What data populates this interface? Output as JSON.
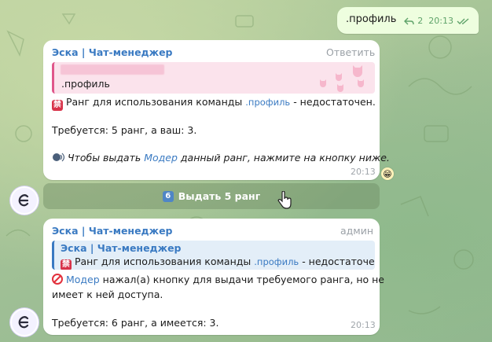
{
  "outgoing": {
    "text": ".профиль",
    "reply_count": "2",
    "time": "20:13",
    "check_icon": "double-check-icon",
    "reply_icon": "reply-arrow-icon"
  },
  "msg1": {
    "sender": "Эска | Чат-менеджер",
    "action": "Ответить",
    "quote_text": ".профиль",
    "line1_pre": "Ранг для использования команды",
    "line1_cmd": ".профиль",
    "line1_post": "- недостаточен.",
    "line2": "Требуется: 5 ранг, а ваш: 3.",
    "line3_pre": "Чтобы выдать",
    "line3_link": "Модер",
    "line3_post": "данный ранг, нажмите на кнопку ниже.",
    "time": "20:13",
    "reaction": "😁"
  },
  "inline_button": {
    "num": "6",
    "label": "Выдать 5 ранг"
  },
  "msg2": {
    "sender": "Эска | Чат-менеджер",
    "role": "админ",
    "quote_sender": "Эска | Чат-менеджер",
    "quote_pre": "Ранг для использования команды",
    "quote_cmd": ".профиль",
    "quote_post": "- недостаточе…",
    "line1_link": "Модер",
    "line1_post": "нажал(а) кнопку для выдачи требуемого ранга, но не",
    "line1b": "имеет к ней доступа.",
    "line2": "Требуется: 6 ранг, а имеется: 3.",
    "time": "20:13"
  },
  "colors": {
    "accent": "#3a7ac2",
    "quote_pink": "#e0578b",
    "outgoing_bg": "#eefedf",
    "emoji_red": "#d8334a"
  }
}
